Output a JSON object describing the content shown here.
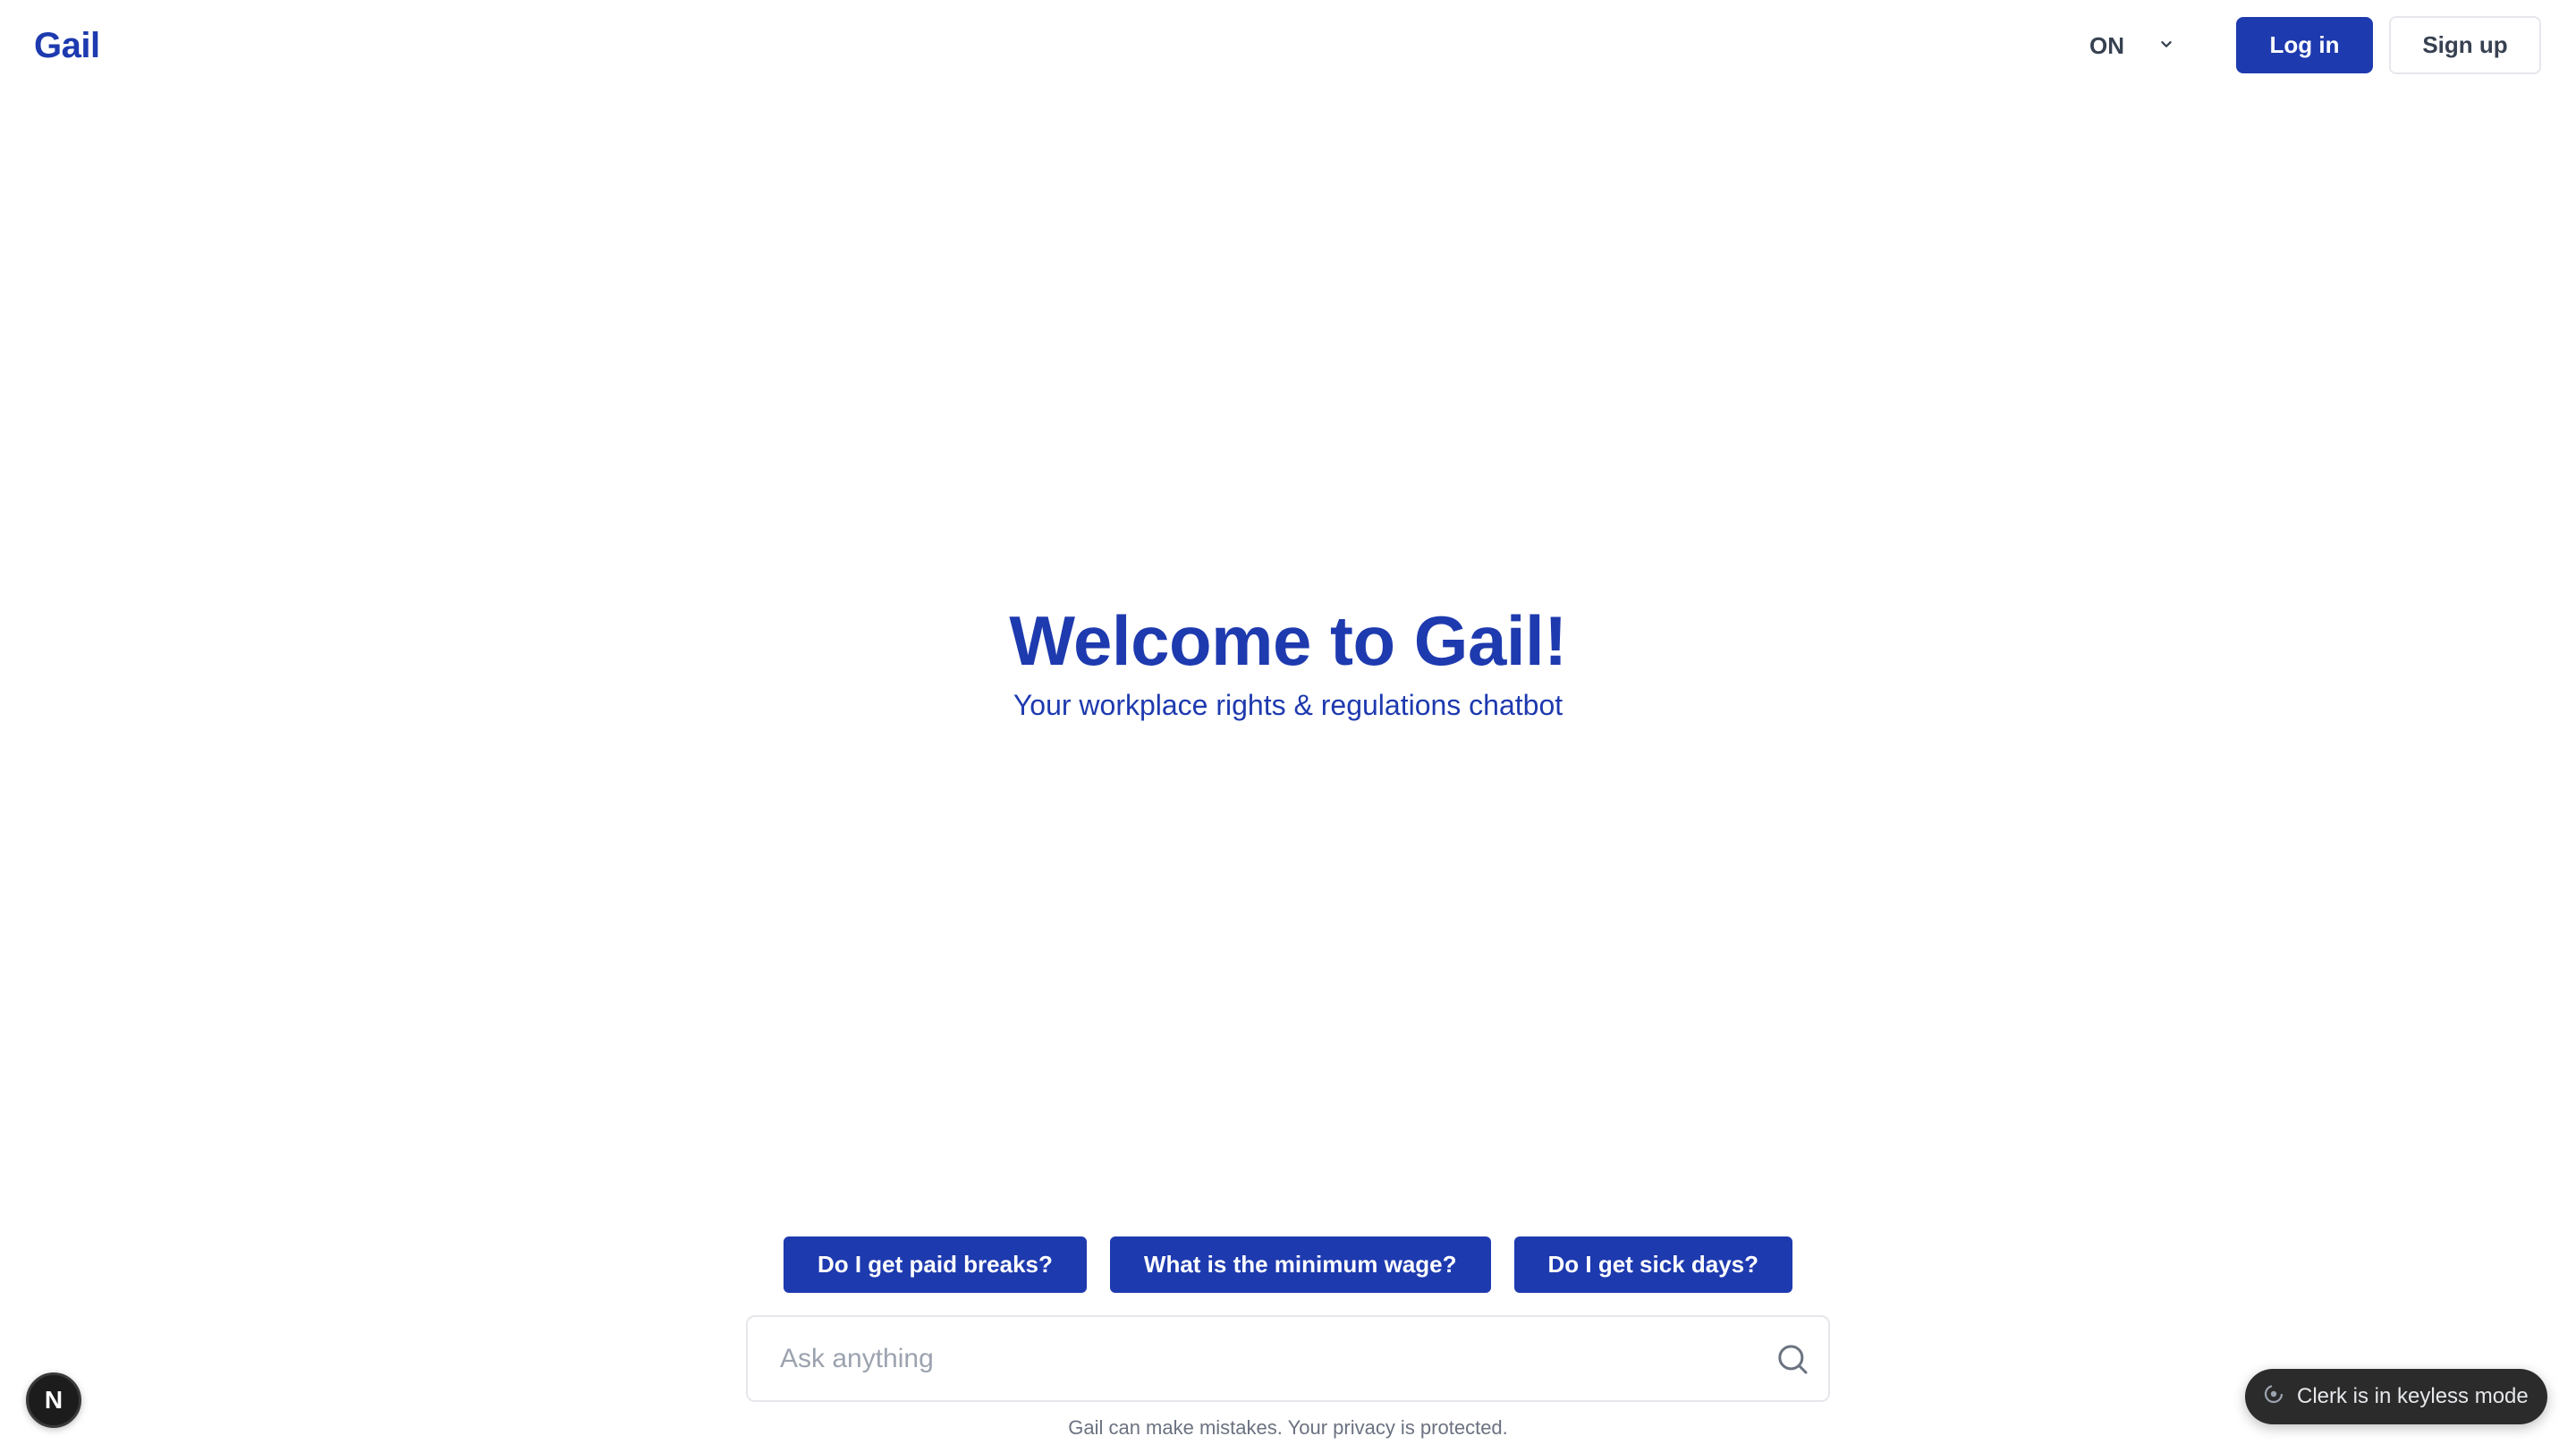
{
  "header": {
    "logo": "Gail",
    "language": "ON",
    "login_label": "Log in",
    "signup_label": "Sign up"
  },
  "hero": {
    "title": "Welcome to Gail!",
    "subtitle": "Your workplace rights & regulations chatbot"
  },
  "suggestions": [
    "Do I get paid breaks?",
    "What is the minimum wage?",
    "Do I get sick days?"
  ],
  "ask": {
    "placeholder": "Ask anything",
    "value": ""
  },
  "disclaimer": "Gail can make mistakes. Your privacy is protected.",
  "next_badge": "N",
  "clerk_toast": "Clerk is in keyless mode",
  "colors": {
    "brand": "#1e3aaf",
    "muted_text": "#6b7280",
    "border": "#e5e7eb",
    "toast_bg": "#2b2b2b"
  },
  "icons": {
    "language_toggle": "chevron-down-icon",
    "ask_submit": "search-icon",
    "clerk": "clerk-icon"
  }
}
